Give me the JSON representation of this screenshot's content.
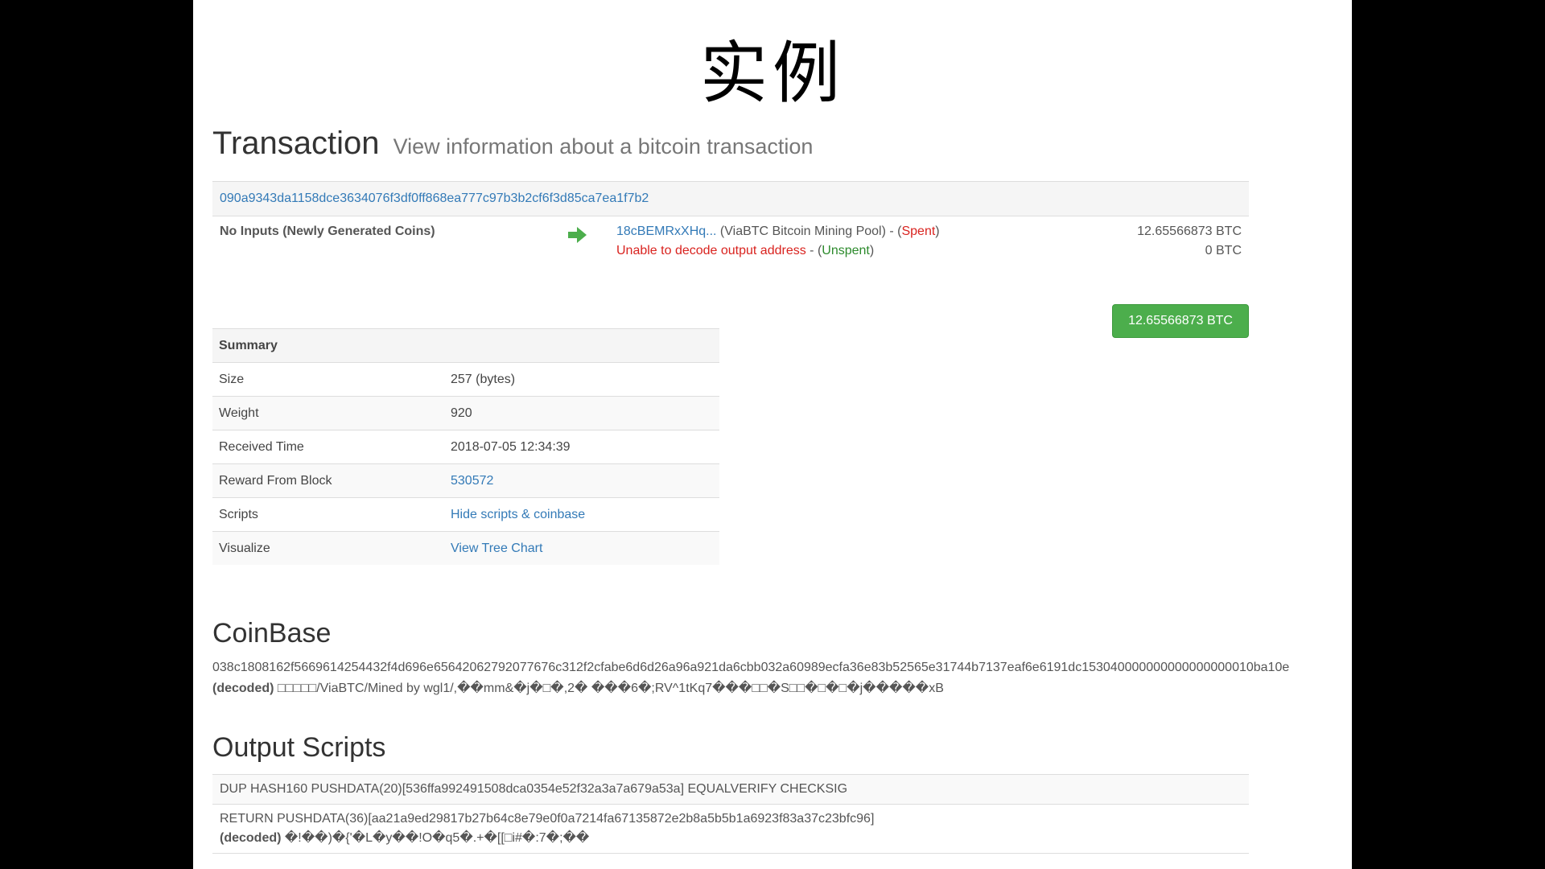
{
  "slide_title": "实例",
  "header": {
    "title": "Transaction",
    "subtitle": "View information about a bitcoin transaction"
  },
  "tx": {
    "hash": "090a9343da1158dce3634076f3df0ff868ea777c97b3b2cf6f3d85ca7ea1f7b2",
    "inputs_label": "No Inputs (Newly Generated Coins)",
    "outputs": [
      {
        "address": "18cBEMRxXHq...",
        "desc": " (ViaBTC Bitcoin Mining Pool) - (",
        "status": "Spent",
        "close": ")",
        "amount": "12.65566873 BTC"
      },
      {
        "address": "Unable to decode output address",
        "desc": " - (",
        "status": "Unspent",
        "close": ")",
        "amount": "0 BTC"
      }
    ],
    "total": "12.65566873 BTC"
  },
  "summary": {
    "heading": "Summary",
    "rows": [
      {
        "label": "Size",
        "value": "257 (bytes)"
      },
      {
        "label": "Weight",
        "value": "920"
      },
      {
        "label": "Received Time",
        "value": "2018-07-05 12:34:39"
      },
      {
        "label": "Reward From Block",
        "value": "530572"
      },
      {
        "label": "Scripts",
        "value": "Hide scripts & coinbase"
      },
      {
        "label": "Visualize",
        "value": "View Tree Chart"
      }
    ]
  },
  "coinbase": {
    "title": "CoinBase",
    "hex": "038c1808162f5669614254432f4d696e65642062792077676c312f2cfabe6d6d26a96a921da6cbb032a60989ecfa36e83b52565e31744b7137eaf6e6191dc153040000000000000000010ba10e",
    "decoded_label": "(decoded)",
    "decoded": " □□□□□/ViaBTC/Mined by wgl1/,��mm&�j�□�,2� ���6�;RV^1tKq7���□□�S□□�□�□�j�����xB"
  },
  "output_scripts": {
    "title": "Output Scripts",
    "script1": "DUP HASH160 PUSHDATA(20)[536ffa992491508dca0354e52f32a3a7a679a53a] EQUALVERIFY CHECKSIG",
    "script2": "RETURN PUSHDATA(36)[aa21a9ed29817b27b64c8e79e0f0a7214fa67135872e2b8a5b5b1a6923f83a37c23bfc96]",
    "decoded_label": "(decoded)",
    "decoded2": " �!��)�{'�L�y��!O�q5�.+�[[□i#�:7�;��"
  }
}
